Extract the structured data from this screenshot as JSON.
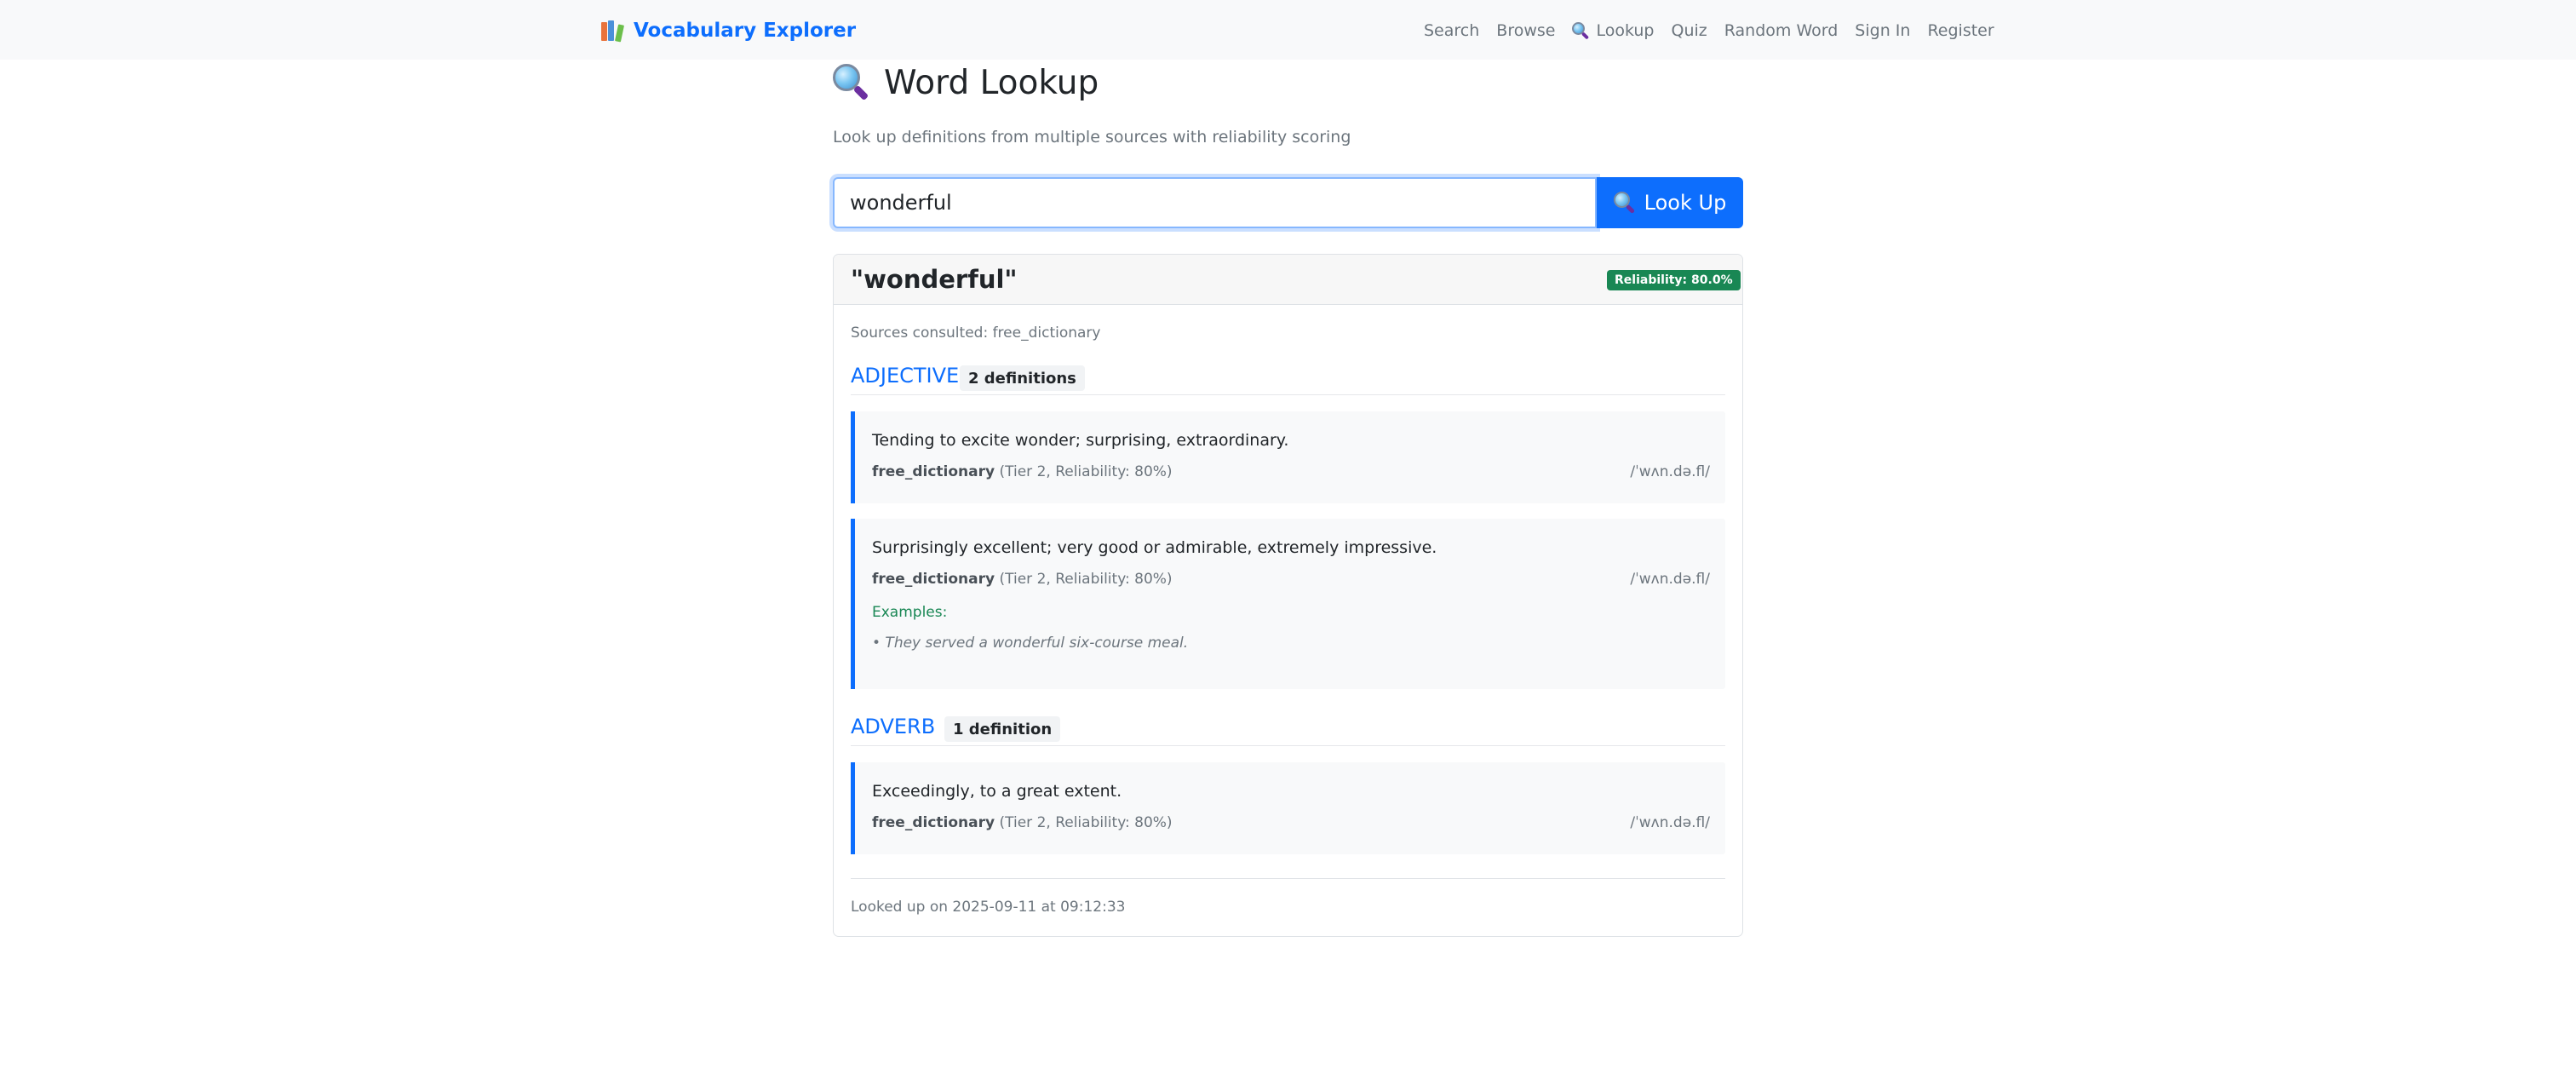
{
  "nav": {
    "brand": "Vocabulary Explorer",
    "brand_icon": "books-icon",
    "links": [
      {
        "label": "Search"
      },
      {
        "label": "Browse"
      },
      {
        "label": "Lookup",
        "icon": "magnifying-glass-icon"
      },
      {
        "label": "Quiz"
      },
      {
        "label": "Random Word"
      },
      {
        "label": "Sign In"
      },
      {
        "label": "Register"
      }
    ]
  },
  "page": {
    "title": "Word Lookup",
    "title_icon": "magnifying-glass-icon",
    "subtitle": "Look up definitions from multiple sources with reliability scoring"
  },
  "search": {
    "value": "wonderful",
    "button_label": "Look Up",
    "button_icon": "magnifying-glass-icon"
  },
  "result": {
    "word": "\"wonderful\"",
    "reliability": "Reliability: 80.0%",
    "sources": "Sources consulted: free_dictionary",
    "groups": [
      {
        "pos": "ADJECTIVE",
        "count": "2 definitions",
        "definitions": [
          {
            "text": "Tending to excite wonder; surprising, extraordinary.",
            "source": "free_dictionary",
            "detail": "(Tier 2, Reliability: 80%)",
            "pronunciation": "/ˈwʌn.də.fl/"
          },
          {
            "text": "Surprisingly excellent; very good or admirable, extremely impressive.",
            "source": "free_dictionary",
            "detail": "(Tier 2, Reliability: 80%)",
            "pronunciation": "/ˈwʌn.də.fl/",
            "examples_label": "Examples:",
            "examples": [
              "• They served a wonderful six-course meal."
            ]
          }
        ]
      },
      {
        "pos": "ADVERB",
        "count": "1 definition",
        "definitions": [
          {
            "text": "Exceedingly, to a great extent.",
            "source": "free_dictionary",
            "detail": "(Tier 2, Reliability: 80%)",
            "pronunciation": "/ˈwʌn.də.fl/"
          }
        ]
      }
    ],
    "timestamp": "Looked up on 2025-09-11 at 09:12:33"
  },
  "colors": {
    "accent": "#0d6efd",
    "success": "#198754",
    "navbar_bg": "#f8f9fa",
    "muted_text": "#6c757d"
  }
}
